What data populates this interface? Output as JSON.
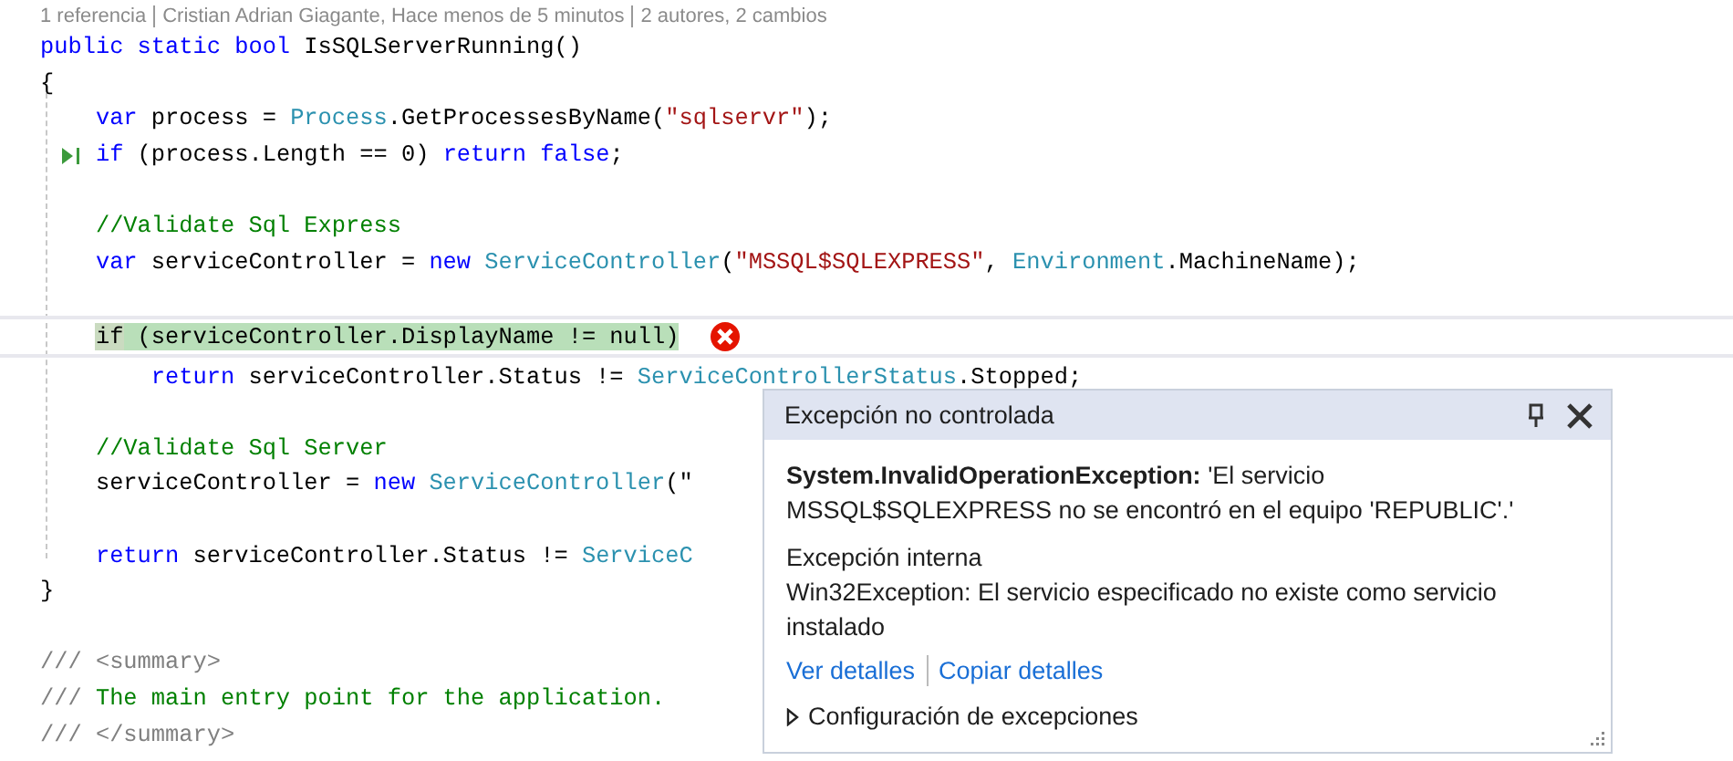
{
  "codelens": [
    "1 referencia",
    "Cristian Adrian Giagante, Hace menos de 5 minutos",
    "2 autores, 2 cambios"
  ],
  "lines": [
    {
      "kind": "code",
      "current": false,
      "run_to_click": false,
      "error": false,
      "segments": [
        {
          "kind": "kw",
          "t": "public static bool"
        },
        {
          "kind": "plain",
          "t": " IsSQLServerRunning()"
        }
      ]
    },
    {
      "kind": "code",
      "current": false,
      "run_to_click": false,
      "error": false,
      "segments": [
        {
          "kind": "plain",
          "t": "{"
        }
      ],
      "children": [
        {
          "kind": "code",
          "current": false,
          "run_to_click": false,
          "error": false,
          "segments": [
            {
              "kind": "kw",
              "t": "var"
            },
            {
              "kind": "plain",
              "t": " process = "
            },
            {
              "kind": "type",
              "t": "Process"
            },
            {
              "kind": "plain",
              "t": ".GetProcessesByName("
            },
            {
              "kind": "str",
              "t": "\"sqlservr\""
            },
            {
              "kind": "plain",
              "t": ");"
            }
          ]
        },
        {
          "kind": "code",
          "current": false,
          "run_to_click": true,
          "error": false,
          "segments": [
            {
              "kind": "kw",
              "t": "if"
            },
            {
              "kind": "plain",
              "t": " (process.Length == 0) "
            },
            {
              "kind": "kw",
              "t": "return false"
            },
            {
              "kind": "plain",
              "t": ";"
            }
          ]
        },
        {
          "kind": "blank",
          "current": false,
          "run_to_click": false,
          "error": false
        },
        {
          "kind": "code",
          "current": false,
          "run_to_click": false,
          "error": false,
          "segments": [
            {
              "kind": "comment",
              "t": "//Validate Sql Express"
            }
          ]
        },
        {
          "kind": "code",
          "current": false,
          "run_to_click": false,
          "error": false,
          "segments": [
            {
              "kind": "kw",
              "t": "var"
            },
            {
              "kind": "plain",
              "t": " serviceController = "
            },
            {
              "kind": "kw",
              "t": "new"
            },
            {
              "kind": "type",
              "t": " ServiceController"
            },
            {
              "kind": "plain",
              "t": "("
            },
            {
              "kind": "str",
              "t": "\"MSSQL$SQLEXPRESS\""
            },
            {
              "kind": "plain",
              "t": ", "
            },
            {
              "kind": "type",
              "t": "Environment"
            },
            {
              "kind": "plain",
              "t": ".MachineName);"
            }
          ]
        },
        {
          "kind": "blank",
          "current": false,
          "run_to_click": false,
          "error": false
        },
        {
          "kind": "code",
          "current": true,
          "run_to_click": false,
          "error": true,
          "segments": [
            {
              "kind": "hl_start",
              "t": "if"
            },
            {
              "kind": "hl",
              "t": " (serviceController.DisplayName != null)"
            }
          ],
          "children": [
            {
              "kind": "code",
              "current": false,
              "run_to_click": false,
              "error": false,
              "segments": [
                {
                  "kind": "kw",
                  "t": "return"
                },
                {
                  "kind": "plain",
                  "t": " serviceController.Status != "
                },
                {
                  "kind": "type",
                  "t": "ServiceControllerStatus"
                },
                {
                  "kind": "plain",
                  "t": ".Stopped;"
                }
              ]
            }
          ]
        },
        {
          "kind": "blank",
          "current": false,
          "run_to_click": false,
          "error": false
        },
        {
          "kind": "code",
          "current": false,
          "run_to_click": false,
          "error": false,
          "segments": [
            {
              "kind": "comment",
              "t": "//Validate Sql Server"
            }
          ]
        },
        {
          "kind": "code",
          "current": false,
          "run_to_click": false,
          "error": false,
          "segments": [
            {
              "kind": "plain",
              "t": "serviceController = "
            },
            {
              "kind": "kw",
              "t": "new"
            },
            {
              "kind": "type",
              "t": " ServiceController"
            },
            {
              "kind": "plain",
              "t": "(\""
            }
          ]
        },
        {
          "kind": "blank",
          "current": false,
          "run_to_click": false,
          "error": false
        },
        {
          "kind": "code",
          "current": false,
          "run_to_click": false,
          "error": false,
          "segments": [
            {
              "kind": "kw",
              "t": "return"
            },
            {
              "kind": "plain",
              "t": " serviceController.Status != "
            },
            {
              "kind": "type",
              "t": "ServiceC"
            }
          ]
        }
      ]
    },
    {
      "kind": "code",
      "current": false,
      "run_to_click": false,
      "error": false,
      "segments": [
        {
          "kind": "plain",
          "t": "}"
        }
      ]
    },
    {
      "kind": "blank",
      "current": false,
      "run_to_click": false,
      "error": false
    },
    {
      "kind": "code",
      "current": false,
      "run_to_click": false,
      "error": false,
      "segments": [
        {
          "kind": "doc",
          "t": "/// <summary>"
        }
      ]
    },
    {
      "kind": "code",
      "current": false,
      "run_to_click": false,
      "error": false,
      "segments": [
        {
          "kind": "doc",
          "t": "///"
        },
        {
          "kind": "comment",
          "t": " The main entry point for the application."
        }
      ]
    },
    {
      "kind": "code",
      "current": false,
      "run_to_click": false,
      "error": false,
      "segments": [
        {
          "kind": "doc",
          "t": "/// </summary>"
        }
      ]
    }
  ],
  "popup": {
    "title": "Excepción no controlada",
    "message": "**System.InvalidOperationException:** 'El servicio MSSQL$SQLEXPRESS no se encontró en el equipo 'REPUBLIC'.'",
    "inner_label": "Excepción interna",
    "inner_message": "Win32Exception: El servicio especificado no existe como servicio instalado",
    "links": [
      "Ver detalles",
      "Copiar detalles"
    ],
    "settings": {
      "label": "Configuración de excepciones",
      "expanded": false
    }
  }
}
